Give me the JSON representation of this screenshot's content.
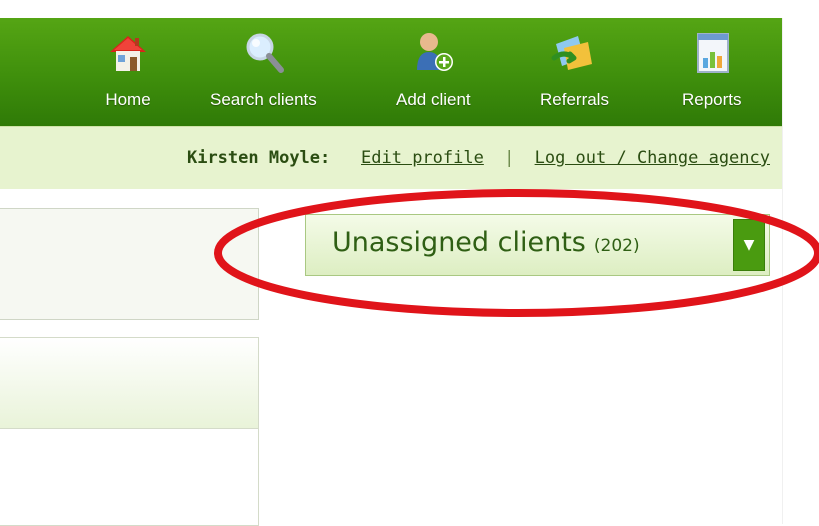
{
  "nav": {
    "items": [
      {
        "label": "Home",
        "icon": "house-icon"
      },
      {
        "label": "Search clients",
        "icon": "magnifier-icon"
      },
      {
        "label": "Add client",
        "icon": "add-person-icon"
      },
      {
        "label": "Referrals",
        "icon": "referrals-icon"
      },
      {
        "label": "Reports",
        "icon": "report-chart-icon"
      }
    ]
  },
  "user": {
    "name": "Kirsten Moyle:",
    "edit_profile": "Edit profile",
    "separator": "|",
    "logout": "Log out / Change agency"
  },
  "unassigned": {
    "title": "Unassigned clients",
    "count": "(202)",
    "toggle_glyph": "▼"
  },
  "colors": {
    "nav_green": "#3f8f0c",
    "user_strip": "#e7f3cf",
    "highlight_red": "#e0141a",
    "button_green": "#4a9b10"
  }
}
